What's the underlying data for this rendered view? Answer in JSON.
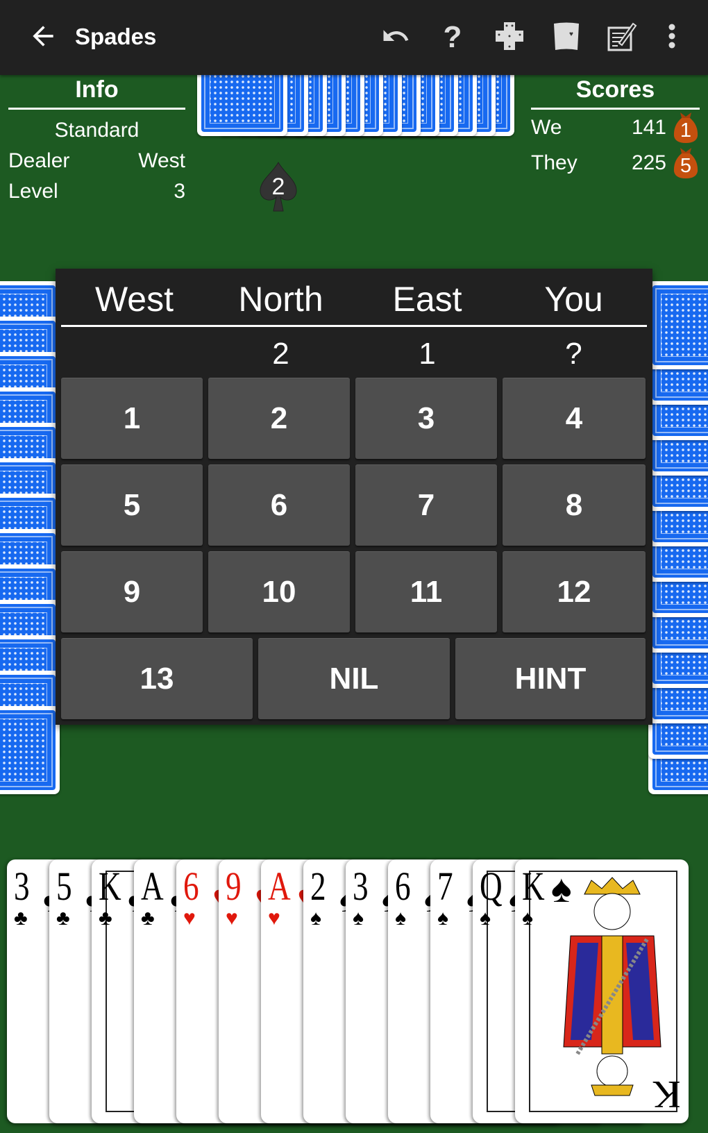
{
  "app_bar": {
    "title": "Spades",
    "back_icon": "arrow-back-icon",
    "actions": [
      {
        "name": "undo",
        "icon": "undo-icon"
      },
      {
        "name": "help",
        "icon": "help-icon"
      },
      {
        "name": "game-layout",
        "icon": "cross-layout-icon"
      },
      {
        "name": "card-deck",
        "icon": "card-fan-icon"
      },
      {
        "name": "score-sheet",
        "icon": "notepad-pencil-icon"
      },
      {
        "name": "more",
        "icon": "more-vert-icon"
      }
    ]
  },
  "info": {
    "heading": "Info",
    "mode": "Standard",
    "rows": [
      {
        "label": "Dealer",
        "value": "West"
      },
      {
        "label": "Level",
        "value": "3"
      }
    ]
  },
  "scores": {
    "heading": "Scores",
    "rows": [
      {
        "team": "We",
        "score": "141",
        "bags": "1"
      },
      {
        "team": "They",
        "score": "225",
        "bags": "5"
      }
    ]
  },
  "north_bid_marker": "2",
  "opponent_hands": {
    "north_cards": 13,
    "west_cards": 13,
    "east_cards": 13
  },
  "bid_dialog": {
    "players": [
      "West",
      "North",
      "East",
      "You"
    ],
    "bids": [
      "",
      "2",
      "1",
      "?"
    ],
    "buttons": [
      "1",
      "2",
      "3",
      "4",
      "5",
      "6",
      "7",
      "8",
      "9",
      "10",
      "11",
      "12"
    ],
    "bottom_buttons": [
      "13",
      "NIL",
      "HINT"
    ]
  },
  "hand": [
    {
      "rank": "3",
      "suit": "♣",
      "color": "black"
    },
    {
      "rank": "5",
      "suit": "♣",
      "color": "black"
    },
    {
      "rank": "K",
      "suit": "♣",
      "color": "black"
    },
    {
      "rank": "A",
      "suit": "♣",
      "color": "black"
    },
    {
      "rank": "6",
      "suit": "♥",
      "color": "red"
    },
    {
      "rank": "9",
      "suit": "♥",
      "color": "red"
    },
    {
      "rank": "A",
      "suit": "♥",
      "color": "red"
    },
    {
      "rank": "2",
      "suit": "♠",
      "color": "black"
    },
    {
      "rank": "3",
      "suit": "♠",
      "color": "black"
    },
    {
      "rank": "6",
      "suit": "♠",
      "color": "black"
    },
    {
      "rank": "7",
      "suit": "♠",
      "color": "black"
    },
    {
      "rank": "Q",
      "suit": "♠",
      "color": "black"
    },
    {
      "rank": "K",
      "suit": "♠",
      "color": "black"
    }
  ],
  "colors": {
    "felt": "#1d5a22",
    "app_bar": "#212121",
    "dialog": "#212121",
    "button": "#4e4e4e",
    "card_back": "#1769f0",
    "bag": "#c4500e",
    "red_suit": "#e0180c"
  }
}
